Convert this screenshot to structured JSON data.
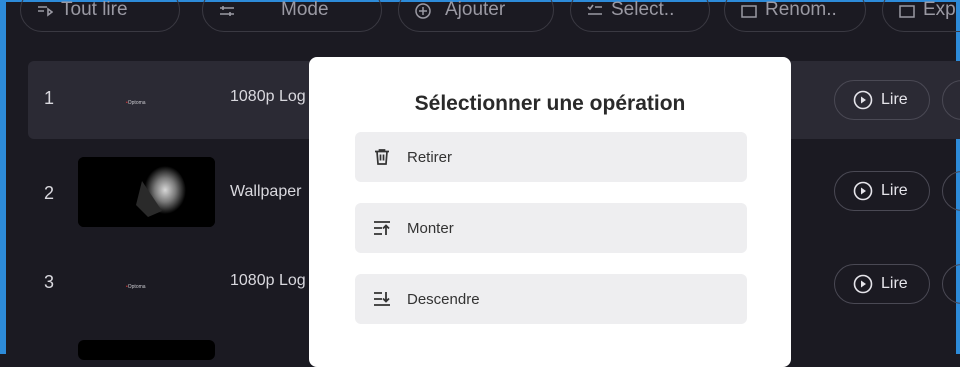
{
  "toolbar": {
    "buttons": [
      {
        "label": "Tout lire",
        "icon": "play-all-icon"
      },
      {
        "label": "Mode",
        "icon": "mode-icon"
      },
      {
        "label": "Ajouter",
        "icon": "add-icon"
      },
      {
        "label": "Select..",
        "icon": "select-icon"
      },
      {
        "label": "Renom..",
        "icon": "rename-icon"
      },
      {
        "label": "Exp",
        "icon": "export-icon"
      }
    ]
  },
  "rows": [
    {
      "num": "1",
      "title": "1080p Log",
      "thumb": "optoma-logo",
      "logo_text": "Optoma",
      "play_label": "Lire"
    },
    {
      "num": "2",
      "title": "Wallpaper",
      "thumb": "lion-image",
      "play_label": "Lire"
    },
    {
      "num": "3",
      "title": "1080p Log",
      "thumb": "optoma-logo",
      "logo_text": "Optoma",
      "play_label": "Lire"
    }
  ],
  "modal": {
    "title": "Sélectionner une opération",
    "options": [
      {
        "label": "Retirer",
        "icon": "trash-icon"
      },
      {
        "label": "Monter",
        "icon": "move-up-icon"
      },
      {
        "label": "Descendre",
        "icon": "move-down-icon"
      }
    ]
  },
  "colors": {
    "background": "#1b1a22",
    "frame": "#2d8bd9",
    "modal": "#ffffff",
    "option_bg": "#eeeef0"
  }
}
